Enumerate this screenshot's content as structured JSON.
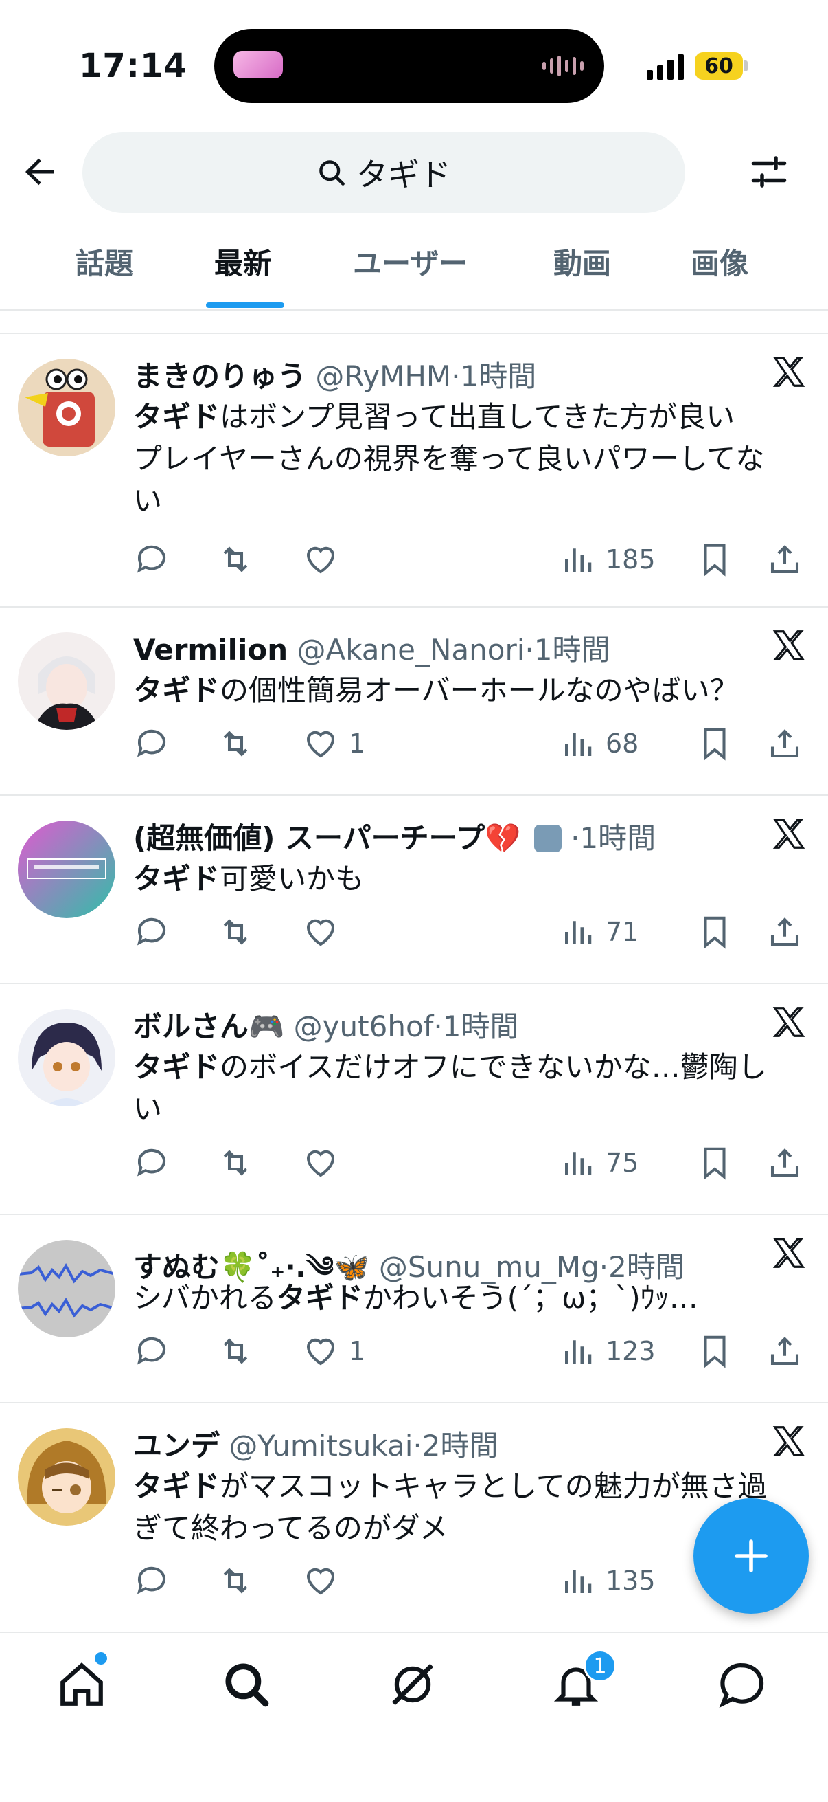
{
  "status": {
    "time": "17:14",
    "battery": "60"
  },
  "search": {
    "query": "タギド"
  },
  "tabs": [
    {
      "label": "話題"
    },
    {
      "label": "最新"
    },
    {
      "label": "ユーザー"
    },
    {
      "label": "動画"
    },
    {
      "label": "画像"
    }
  ],
  "posts": [
    {
      "name": "まきのりゅう",
      "handle": "@RyMHM",
      "time": "·1時間",
      "bold": "タギド",
      "text1": "はボンプ見習って出直してきた方が良い",
      "text2": "プレイヤーさんの視界を奪って良いパワーしてない",
      "likes": "",
      "views": "185"
    },
    {
      "name": "Vermilion",
      "handle": "@Akane_Nanori",
      "time": "·1時間",
      "bold": "タギド",
      "text1": "の個性簡易オーバーホールなのやばい？",
      "text2": "",
      "likes": "1",
      "views": "68"
    },
    {
      "name": "(超無価値) スーパーチープ💔",
      "handle": "",
      "time": "·1時間",
      "bold": "タギド",
      "text1": "可愛いかも",
      "text2": "",
      "likes": "",
      "views": "71"
    },
    {
      "name": "ボルさん🎮",
      "handle": "@yut6hof",
      "time": "·1時間",
      "bold": "タギド",
      "text1": "のボイスだけオフにできないかな…鬱陶しい",
      "text2": "",
      "likes": "",
      "views": "75"
    },
    {
      "name": "すぬむ🍀˚₊‧.༄🦋",
      "handle": "@Sunu_mu_Mg",
      "time": "·2時間",
      "pre": "シバかれる",
      "bold": "タギド",
      "text1": "かわいそう(´；ω；`)ｳｯ…",
      "text2": "",
      "likes": "1",
      "views": "123"
    },
    {
      "name": "ユンデ",
      "handle": "@Yumitsukai",
      "time": "·2時間",
      "bold": "タギド",
      "text1": "がマスコットキャラとしての魅力が無さ過ぎて終わってるのがダメ",
      "text2": "",
      "likes": "",
      "views": "135"
    }
  ],
  "nav": {
    "notifications_badge": "1"
  },
  "colors": {
    "accent": "#1d9bf0",
    "text": "#0f1419",
    "muted": "#536471"
  }
}
